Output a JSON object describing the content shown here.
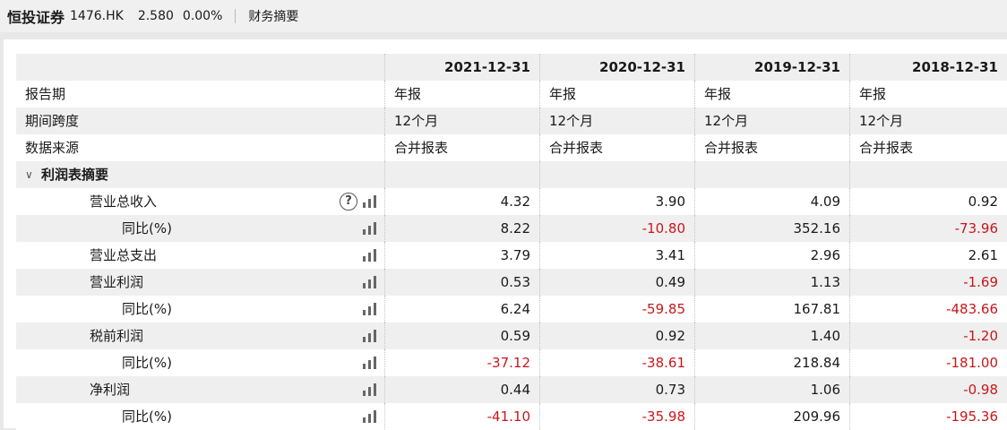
{
  "header": {
    "company_name": "恒投证券",
    "stock_code": "1476.HK",
    "price": "2.580",
    "change_pct": "0.00%",
    "page_title": "财务摘要"
  },
  "table": {
    "columns": [
      "2021-12-31",
      "2020-12-31",
      "2019-12-31",
      "2018-12-31"
    ],
    "meta_rows": [
      {
        "label": "报告期",
        "values": [
          "年报",
          "年报",
          "年报",
          "年报"
        ]
      },
      {
        "label": "期间跨度",
        "values": [
          "12个月",
          "12个月",
          "12个月",
          "12个月"
        ]
      },
      {
        "label": "数据来源",
        "values": [
          "合并报表",
          "合并报表",
          "合并报表",
          "合并报表"
        ]
      }
    ],
    "section_title": "利润表摘要",
    "data_rows": [
      {
        "label": "营业总收入",
        "level": 1,
        "help": true,
        "values": [
          "4.32",
          "3.90",
          "4.09",
          "0.92"
        ]
      },
      {
        "label": "同比(%)",
        "level": 2,
        "values": [
          "8.22",
          "-10.80",
          "352.16",
          "-73.96"
        ]
      },
      {
        "label": "营业总支出",
        "level": 1,
        "values": [
          "3.79",
          "3.41",
          "2.96",
          "2.61"
        ]
      },
      {
        "label": "营业利润",
        "level": 1,
        "values": [
          "0.53",
          "0.49",
          "1.13",
          "-1.69"
        ]
      },
      {
        "label": "同比(%)",
        "level": 2,
        "values": [
          "6.24",
          "-59.85",
          "167.81",
          "-483.66"
        ]
      },
      {
        "label": "税前利润",
        "level": 1,
        "values": [
          "0.59",
          "0.92",
          "1.40",
          "-1.20"
        ]
      },
      {
        "label": "同比(%)",
        "level": 2,
        "values": [
          "-37.12",
          "-38.61",
          "218.84",
          "-181.00"
        ]
      },
      {
        "label": "净利润",
        "level": 1,
        "values": [
          "0.44",
          "0.73",
          "1.06",
          "-0.98"
        ]
      },
      {
        "label": "同比(%)",
        "level": 2,
        "values": [
          "-41.10",
          "-35.98",
          "209.96",
          "-195.36"
        ]
      }
    ],
    "help_symbol": "?",
    "negative_color": "#c8171b"
  }
}
